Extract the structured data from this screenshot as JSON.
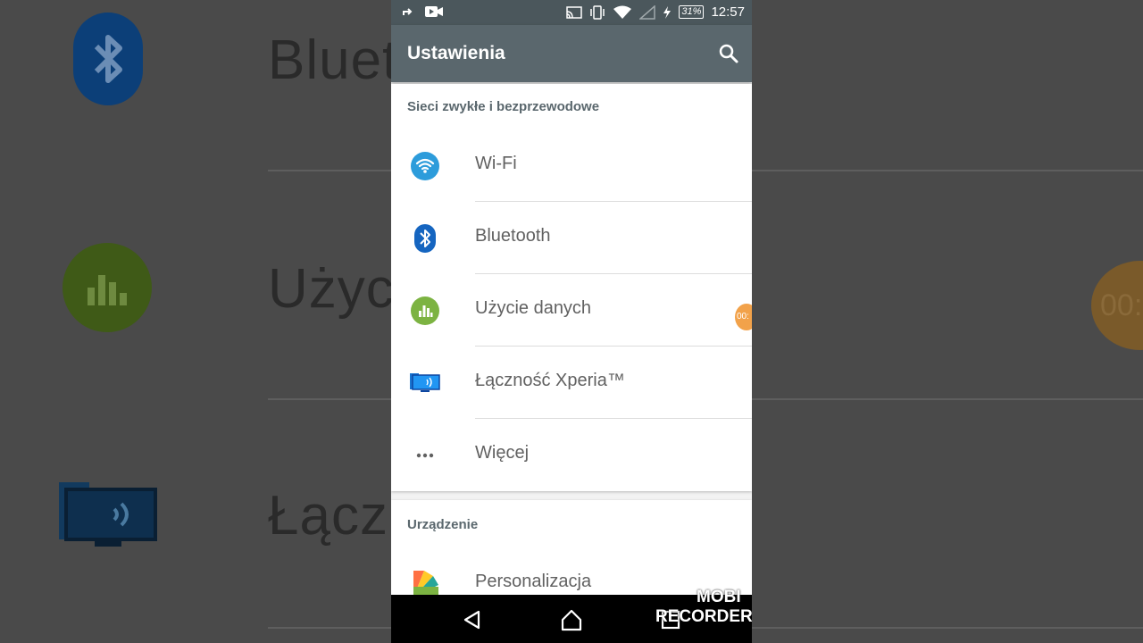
{
  "background": {
    "labels": [
      "Bluet",
      "Użyc",
      "Łącz"
    ],
    "timer_text": "00:"
  },
  "statusbar": {
    "time": "12:57",
    "battery": "31%"
  },
  "appbar": {
    "title": "Ustawienia",
    "search_icon": "search-icon"
  },
  "sections": [
    {
      "header": "Sieci zwykłe i bezprzewodowe",
      "items": [
        {
          "label": "Wi-Fi",
          "icon": "wifi-icon"
        },
        {
          "label": "Bluetooth",
          "icon": "bluetooth-icon"
        },
        {
          "label": "Użycie danych",
          "icon": "data-usage-icon"
        },
        {
          "label": "Łączność Xperia™",
          "icon": "xperia-connectivity-icon"
        },
        {
          "label": "Więcej",
          "icon": "more-icon"
        }
      ]
    },
    {
      "header": "Urządzenie",
      "items": [
        {
          "label": "Personalizacja",
          "icon": "personalization-icon"
        }
      ]
    }
  ],
  "overlay": {
    "timer": "00:",
    "watermark_line1": "MOBI",
    "watermark_line2": "RECORDER"
  },
  "colors": {
    "appbar": "#5a676d",
    "statusbar": "#4b575c",
    "wifi": "#2d9cdb",
    "bluetooth": "#1565c0",
    "data": "#7cb342"
  }
}
